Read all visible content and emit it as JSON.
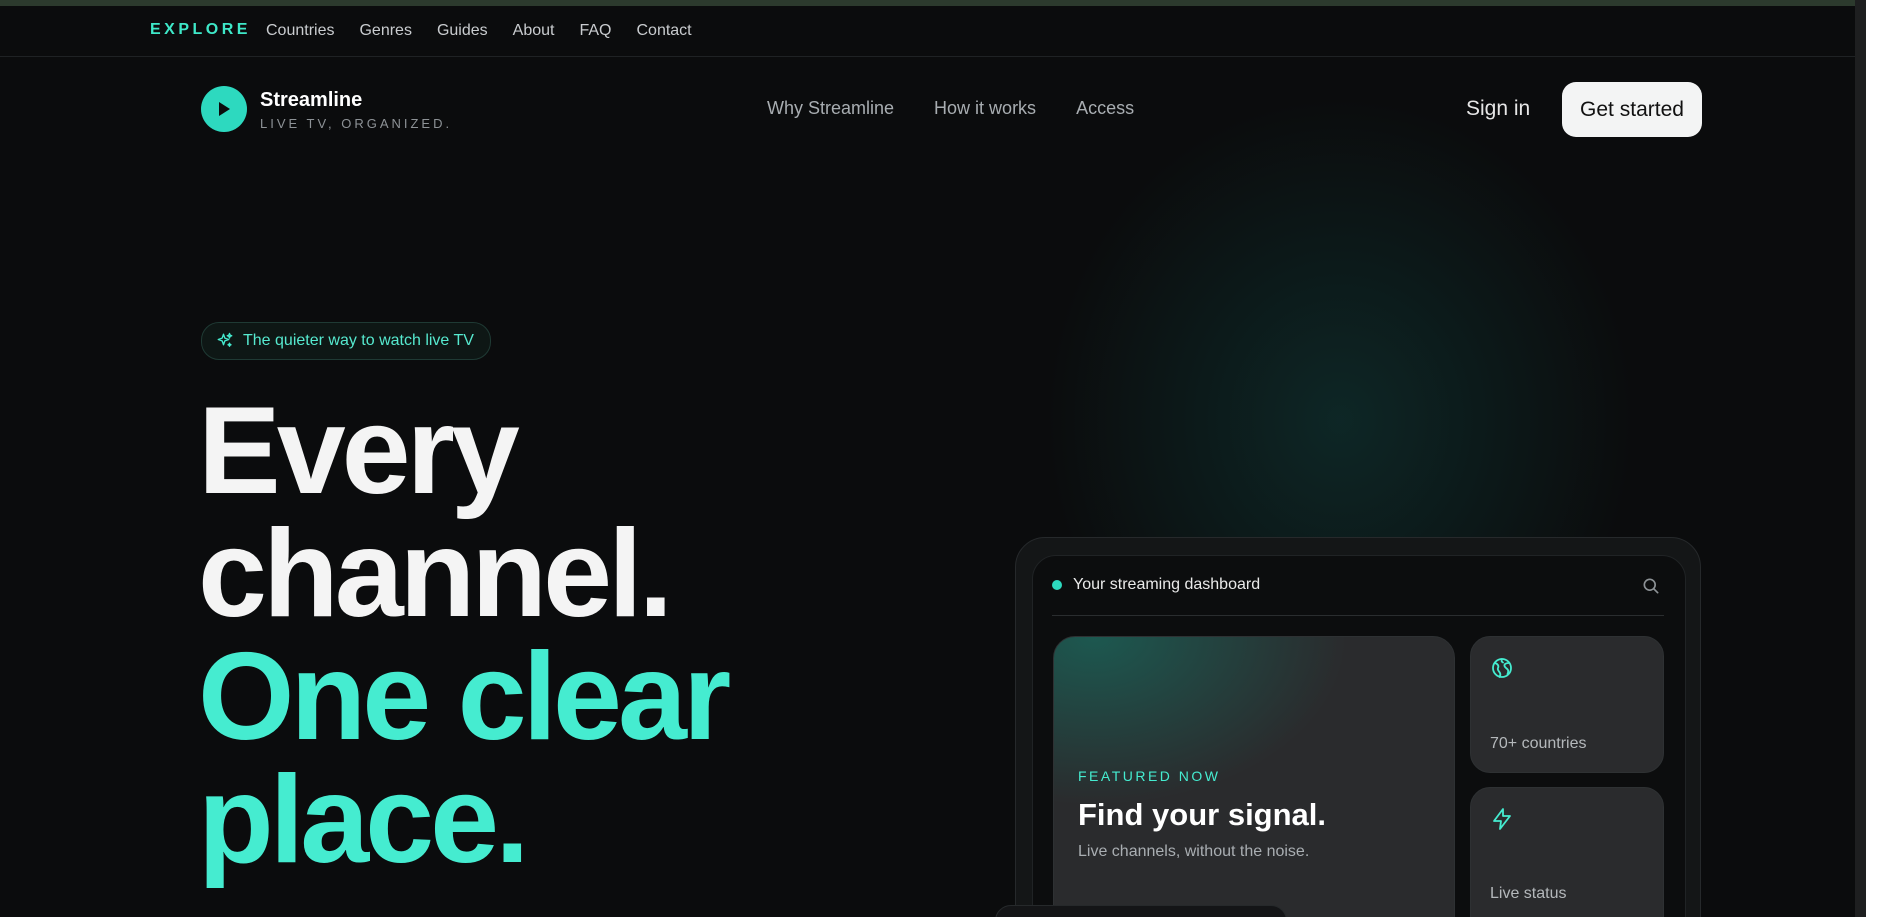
{
  "explore_bar": {
    "brand": "EXPLORE",
    "links": [
      "Countries",
      "Genres",
      "Guides",
      "About",
      "FAQ",
      "Contact"
    ]
  },
  "brand": {
    "name": "Streamline",
    "tagline": "LIVE TV, ORGANIZED.",
    "logo_icon": "play-icon"
  },
  "nav": {
    "links": [
      "Why Streamline",
      "How it works",
      "Access"
    ],
    "sign_in": "Sign in",
    "get_started": "Get started"
  },
  "hero": {
    "badge": "The quieter way to watch live TV",
    "badge_icon": "sparkles-icon",
    "headline_white": [
      "Every",
      "channel."
    ],
    "headline_accent": [
      "One clear",
      "place."
    ]
  },
  "dashboard": {
    "title": "Your streaming dashboard",
    "search_icon": "search-icon",
    "featured": {
      "kicker": "FEATURED NOW",
      "title": "Find your signal.",
      "subtitle": "Live channels, without the noise."
    },
    "stats": [
      {
        "icon": "globe-icon",
        "label": "70+ countries"
      },
      {
        "icon": "lightning-icon",
        "label": "Live status"
      }
    ]
  },
  "colors": {
    "accent": "#45ECD0",
    "background": "#0B0C0D",
    "button_light": "#F3F4F4"
  }
}
